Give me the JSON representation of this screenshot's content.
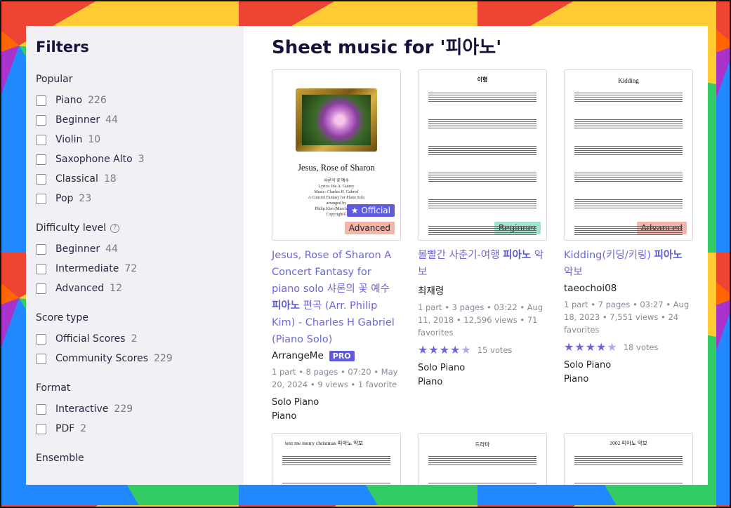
{
  "sidebar": {
    "title": "Filters",
    "groups": [
      {
        "title": "Popular",
        "options": [
          {
            "label": "Piano",
            "count": "226"
          },
          {
            "label": "Beginner",
            "count": "44"
          },
          {
            "label": "Violin",
            "count": "10"
          },
          {
            "label": "Saxophone Alto",
            "count": "3"
          },
          {
            "label": "Classical",
            "count": "18"
          },
          {
            "label": "Pop",
            "count": "23"
          }
        ]
      },
      {
        "title": "Difficulty level",
        "help": "?",
        "options": [
          {
            "label": "Beginner",
            "count": "44"
          },
          {
            "label": "Intermediate",
            "count": "72"
          },
          {
            "label": "Advanced",
            "count": "12"
          }
        ]
      },
      {
        "title": "Score type",
        "options": [
          {
            "label": "Official Scores",
            "count": "2"
          },
          {
            "label": "Community Scores",
            "count": "229"
          }
        ]
      },
      {
        "title": "Format",
        "options": [
          {
            "label": "Interactive",
            "count": "229"
          },
          {
            "label": "PDF",
            "count": "2"
          }
        ]
      },
      {
        "title": "Ensemble",
        "options": []
      }
    ]
  },
  "main": {
    "heading": "Sheet music for '피아노'",
    "cards": [
      {
        "thumb_title": "Jesus, Rose of Sharon",
        "thumb_sub1": "샤론의 꽃 예수",
        "thumb_sub2": "Lyrics: Ida A. Guirey",
        "thumb_sub3": "Music: Charles H. Gabriel",
        "thumb_sub4": "A Concert Fantasy for Piano Solo",
        "thumb_sub5": "arranged by",
        "thumb_sub6": "Philip Kim (March 2000)",
        "thumb_sub7": "Copyright©",
        "badge_official": "★ Official",
        "badge_level": "Advanced",
        "title_pre": "Jesus, Rose of Sharon A Concert Fantasy for piano solo 샤론의 꽃 예수 ",
        "title_bold": "피아노",
        "title_post": " 편곡 (Arr. Philip Kim) - Charles H Gabriel (Piano Solo)",
        "author": "ArrangeMe",
        "pro": "PRO",
        "meta": "1 part • 8 pages • 07:20 • May 20, 2024 • 9 views • 1 favorite",
        "inst1": "Solo Piano",
        "inst2": "Piano"
      },
      {
        "thumb_title": "이형",
        "badge_level": "Beginner",
        "title_pre": "볼빨간 사춘기-여행 ",
        "title_bold": "피아노",
        "title_post": " 악보",
        "author": "최재령",
        "meta": "1 part • 3 pages • 03:22 • Aug 11, 2018 • 12,596 views • 71 favorites",
        "rating": 4.5,
        "votes": "15 votes",
        "inst1": "Solo Piano",
        "inst2": "Piano"
      },
      {
        "thumb_title": "Kidding",
        "badge_level": "Advanced",
        "title_pre": "Kidding(키딩/키링) ",
        "title_bold": "피아노",
        "title_post": " 악보",
        "author": "taeochoi08",
        "meta": "1 part • 7 pages • 03:27 • Aug 18, 2023 • 7,551 views • 24 favorites",
        "rating": 4.5,
        "votes": "18 votes",
        "inst1": "Solo Piano",
        "inst2": "Piano"
      },
      {
        "thumb_title": "text me merry christmas  피아노 악보"
      },
      {
        "thumb_title": "드라마"
      },
      {
        "thumb_title": "2002 피아노 악보"
      }
    ]
  }
}
